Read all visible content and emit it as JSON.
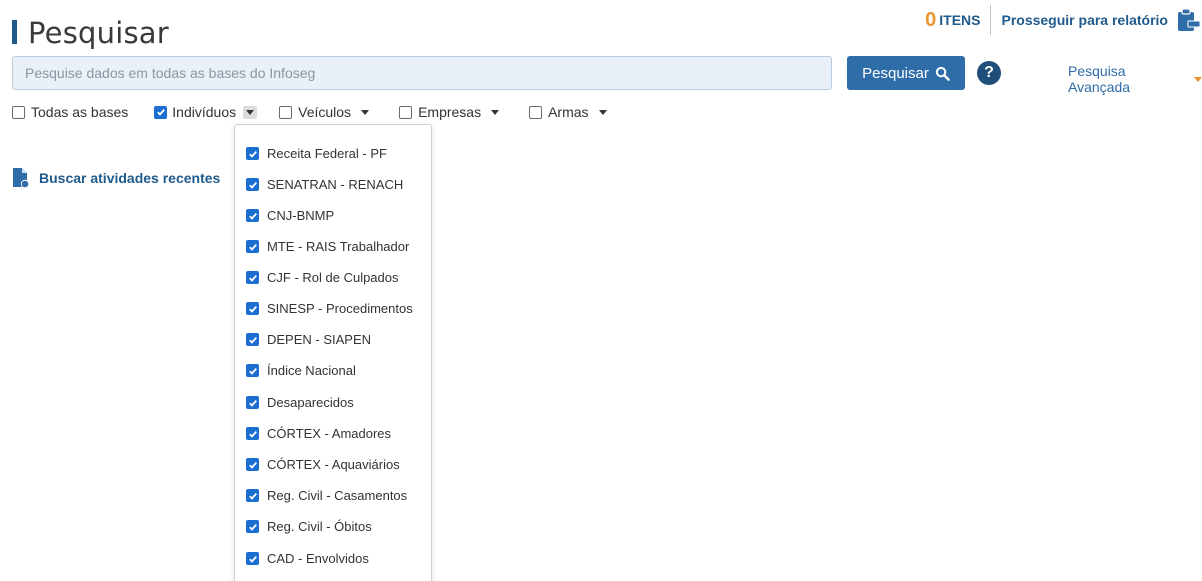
{
  "page": {
    "title": "Pesquisar"
  },
  "cart": {
    "count": "0",
    "label": "ITENS",
    "report_link": "Prosseguir para relatório"
  },
  "search": {
    "placeholder": "Pesquise dados em todas as bases do Infoseg",
    "button_label": "Pesquisar",
    "help": "?",
    "advanced_label": "Pesquisa Avançada"
  },
  "filters": [
    {
      "label": "Todas as bases",
      "checked": false,
      "has_caret": false
    },
    {
      "label": "Indivíduos",
      "checked": true,
      "has_caret": true,
      "caret_active": true
    },
    {
      "label": "Veículos",
      "checked": false,
      "has_caret": true
    },
    {
      "label": "Empresas",
      "checked": false,
      "has_caret": true
    },
    {
      "label": "Armas",
      "checked": false,
      "has_caret": true
    }
  ],
  "recent": {
    "label": "Buscar atividades recentes"
  },
  "dropdown": {
    "items": [
      {
        "label": "Receita Federal - PF",
        "checked": true
      },
      {
        "label": "SENATRAN - RENACH",
        "checked": true
      },
      {
        "label": "CNJ-BNMP",
        "checked": true
      },
      {
        "label": "MTE - RAIS Trabalhador",
        "checked": true
      },
      {
        "label": "CJF - Rol de Culpados",
        "checked": true
      },
      {
        "label": "SINESP - Procedimentos",
        "checked": true
      },
      {
        "label": "DEPEN - SIAPEN",
        "checked": true
      },
      {
        "label": "Índice Nacional",
        "checked": true
      },
      {
        "label": "Desaparecidos",
        "checked": true
      },
      {
        "label": "CÓRTEX - Amadores",
        "checked": true
      },
      {
        "label": "CÓRTEX - Aquaviários",
        "checked": true
      },
      {
        "label": "Reg. Civil - Casamentos",
        "checked": true
      },
      {
        "label": "Reg. Civil - Óbitos",
        "checked": true
      },
      {
        "label": "CAD - Envolvidos",
        "checked": true
      }
    ]
  },
  "colors": {
    "brand": "#1f5a8c",
    "accent": "#e8962e",
    "button": "#2e6da8",
    "checkbox": "#1c6fd1"
  }
}
